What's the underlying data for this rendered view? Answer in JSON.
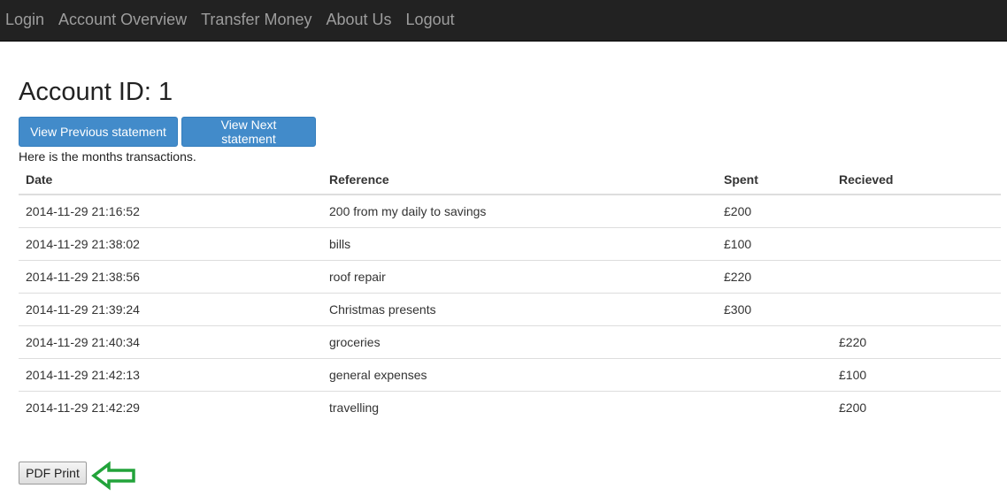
{
  "nav": {
    "items": [
      {
        "label": "Login"
      },
      {
        "label": "Account Overview"
      },
      {
        "label": "Transfer Money"
      },
      {
        "label": "About Us"
      },
      {
        "label": "Logout"
      }
    ]
  },
  "page": {
    "title": "Account ID: 1",
    "prev_button": "View Previous statement",
    "next_button": "View Next statement",
    "intro": "Here is the months transactions."
  },
  "table": {
    "headers": [
      "Date",
      "Reference",
      "Spent",
      "Recieved"
    ],
    "rows": [
      {
        "date": "2014-11-29 21:16:52",
        "reference": "200 from my daily to savings",
        "spent": "£200",
        "received": ""
      },
      {
        "date": "2014-11-29 21:38:02",
        "reference": "bills",
        "spent": "£100",
        "received": ""
      },
      {
        "date": "2014-11-29 21:38:56",
        "reference": "roof repair",
        "spent": "£220",
        "received": ""
      },
      {
        "date": "2014-11-29 21:39:24",
        "reference": "Christmas presents",
        "spent": "£300",
        "received": ""
      },
      {
        "date": "2014-11-29 21:40:34",
        "reference": "groceries",
        "spent": "",
        "received": "£220"
      },
      {
        "date": "2014-11-29 21:42:13",
        "reference": "general expenses",
        "spent": "",
        "received": "£100"
      },
      {
        "date": "2014-11-29 21:42:29",
        "reference": "travelling",
        "spent": "",
        "received": "£200"
      }
    ]
  },
  "actions": {
    "pdf_print": "PDF Print"
  },
  "colors": {
    "navbar_bg": "#222222",
    "nav_text": "#9d9d9d",
    "primary": "#428bca",
    "annotation_arrow": "#22a33a"
  }
}
